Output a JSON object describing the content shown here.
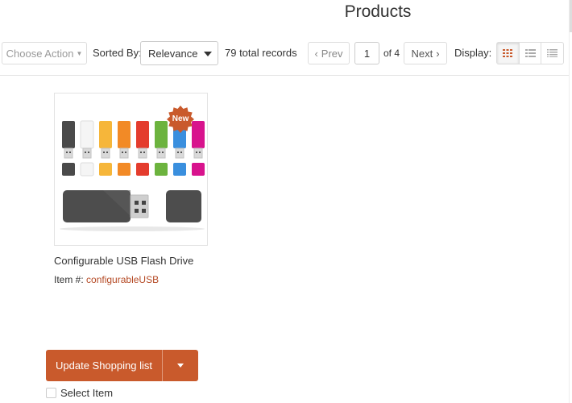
{
  "page": {
    "title": "Products"
  },
  "toolbar": {
    "choose_action": "Choose Action",
    "sorted_by_label": "Sorted By:",
    "sort_value": "Relevance",
    "total_records": "79 total records",
    "prev_label": "Prev",
    "page_number": "1",
    "of_pages": "of 4",
    "next_label": "Next",
    "display_label": "Display:",
    "views": [
      "grid-view-icon",
      "list-view-icon",
      "compact-list-icon"
    ],
    "active_view": "grid"
  },
  "product": {
    "badge": "New",
    "name": "Configurable USB Flash Drive",
    "item_label": "Item #:",
    "item_number": "configurableUSB",
    "update_label": "Update Shopping list",
    "select_label": "Select Item"
  },
  "colors": {
    "accent": "#c95a2c",
    "link": "#b54a25",
    "active_view_icon": "#c95a2c",
    "usb_caps": [
      "#4a4a4a",
      "#f5f5f5",
      "#f6b63a",
      "#f28a26",
      "#e43c2d",
      "#6cb33e",
      "#3a8fde",
      "#d8138d"
    ]
  }
}
